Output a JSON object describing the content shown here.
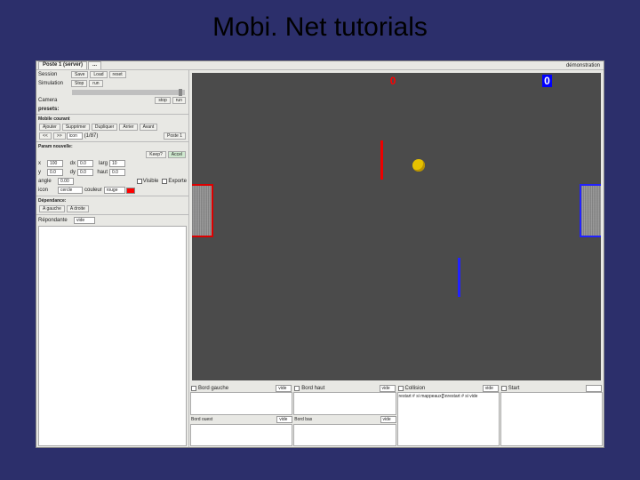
{
  "slide": {
    "title": "Mobi. Net tutorials"
  },
  "tabs": {
    "t1": "Poste",
    "t1b": "1 (server)",
    "t2": "...",
    "tmode": "démonstration"
  },
  "session": {
    "label": "Session",
    "btn_save": "Save",
    "btn_load": "Load",
    "btn_reset": "reset"
  },
  "simul": {
    "label": "Simulation",
    "btn_stop": "Stop",
    "btn_run": "run"
  },
  "camera": {
    "label": "Camera",
    "btn_stop": "stop",
    "btn_run": "run"
  },
  "presets": {
    "label": "presets:"
  },
  "mobile": {
    "hdr": "Mobile courant",
    "btn_add": "Ajouter",
    "btn_del": "Supprimer",
    "btn_dup": "Dupliquer",
    "btn_prev": "Arrier",
    "btn_next": "Avant",
    "sel_left": "<<",
    "sel_right": ">>",
    "icon_lbl": "icon",
    "n_of": "(1/87)",
    "btn_poste": "Poste 1"
  },
  "geom": {
    "hdr": "Param nouvelle:",
    "keep": "Keep?",
    "accel": "Accel",
    "x_lbl": "x",
    "x_val": "100",
    "dx_lbl": "dx",
    "dx_val": "0.0",
    "larg_lbl": "larg",
    "larg_val": "10",
    "y_lbl": "y",
    "y_val": "0.0",
    "dy_lbl": "dy",
    "dy_val": "0.0",
    "haut_lbl": "haut",
    "haut_val": "0.0",
    "angle_lbl": "angle",
    "angle_val": "0.00",
    "visible_lbl": "Visible",
    "exporte_lbl": "Exporte",
    "icon_lbl": "icon",
    "icon_choice": "cercle",
    "couleur_lbl": "couleur",
    "couleur_val": "rouge"
  },
  "deps": {
    "hdr": "Dépendance:",
    "btn1": "A gauche",
    "btn2": "A droite"
  },
  "reply": {
    "label": "Répondante",
    "val": "vide"
  },
  "bottom": {
    "p1": {
      "title": "Bord gauche",
      "val": "vide",
      "sub": "Bord ouest",
      "sub_val": "vide"
    },
    "p2": {
      "title": "Bord haut",
      "val": "vide",
      "sub": "Bord bas",
      "sub_val": "vide"
    },
    "p3": {
      "title": "Collision",
      "val": "vide",
      "body": "restart # si mappeaux[]\\nrestart # si vide"
    },
    "p4": {
      "title": "Start",
      "val": ""
    }
  },
  "play": {
    "score_red": "0",
    "score_blue": "0"
  }
}
